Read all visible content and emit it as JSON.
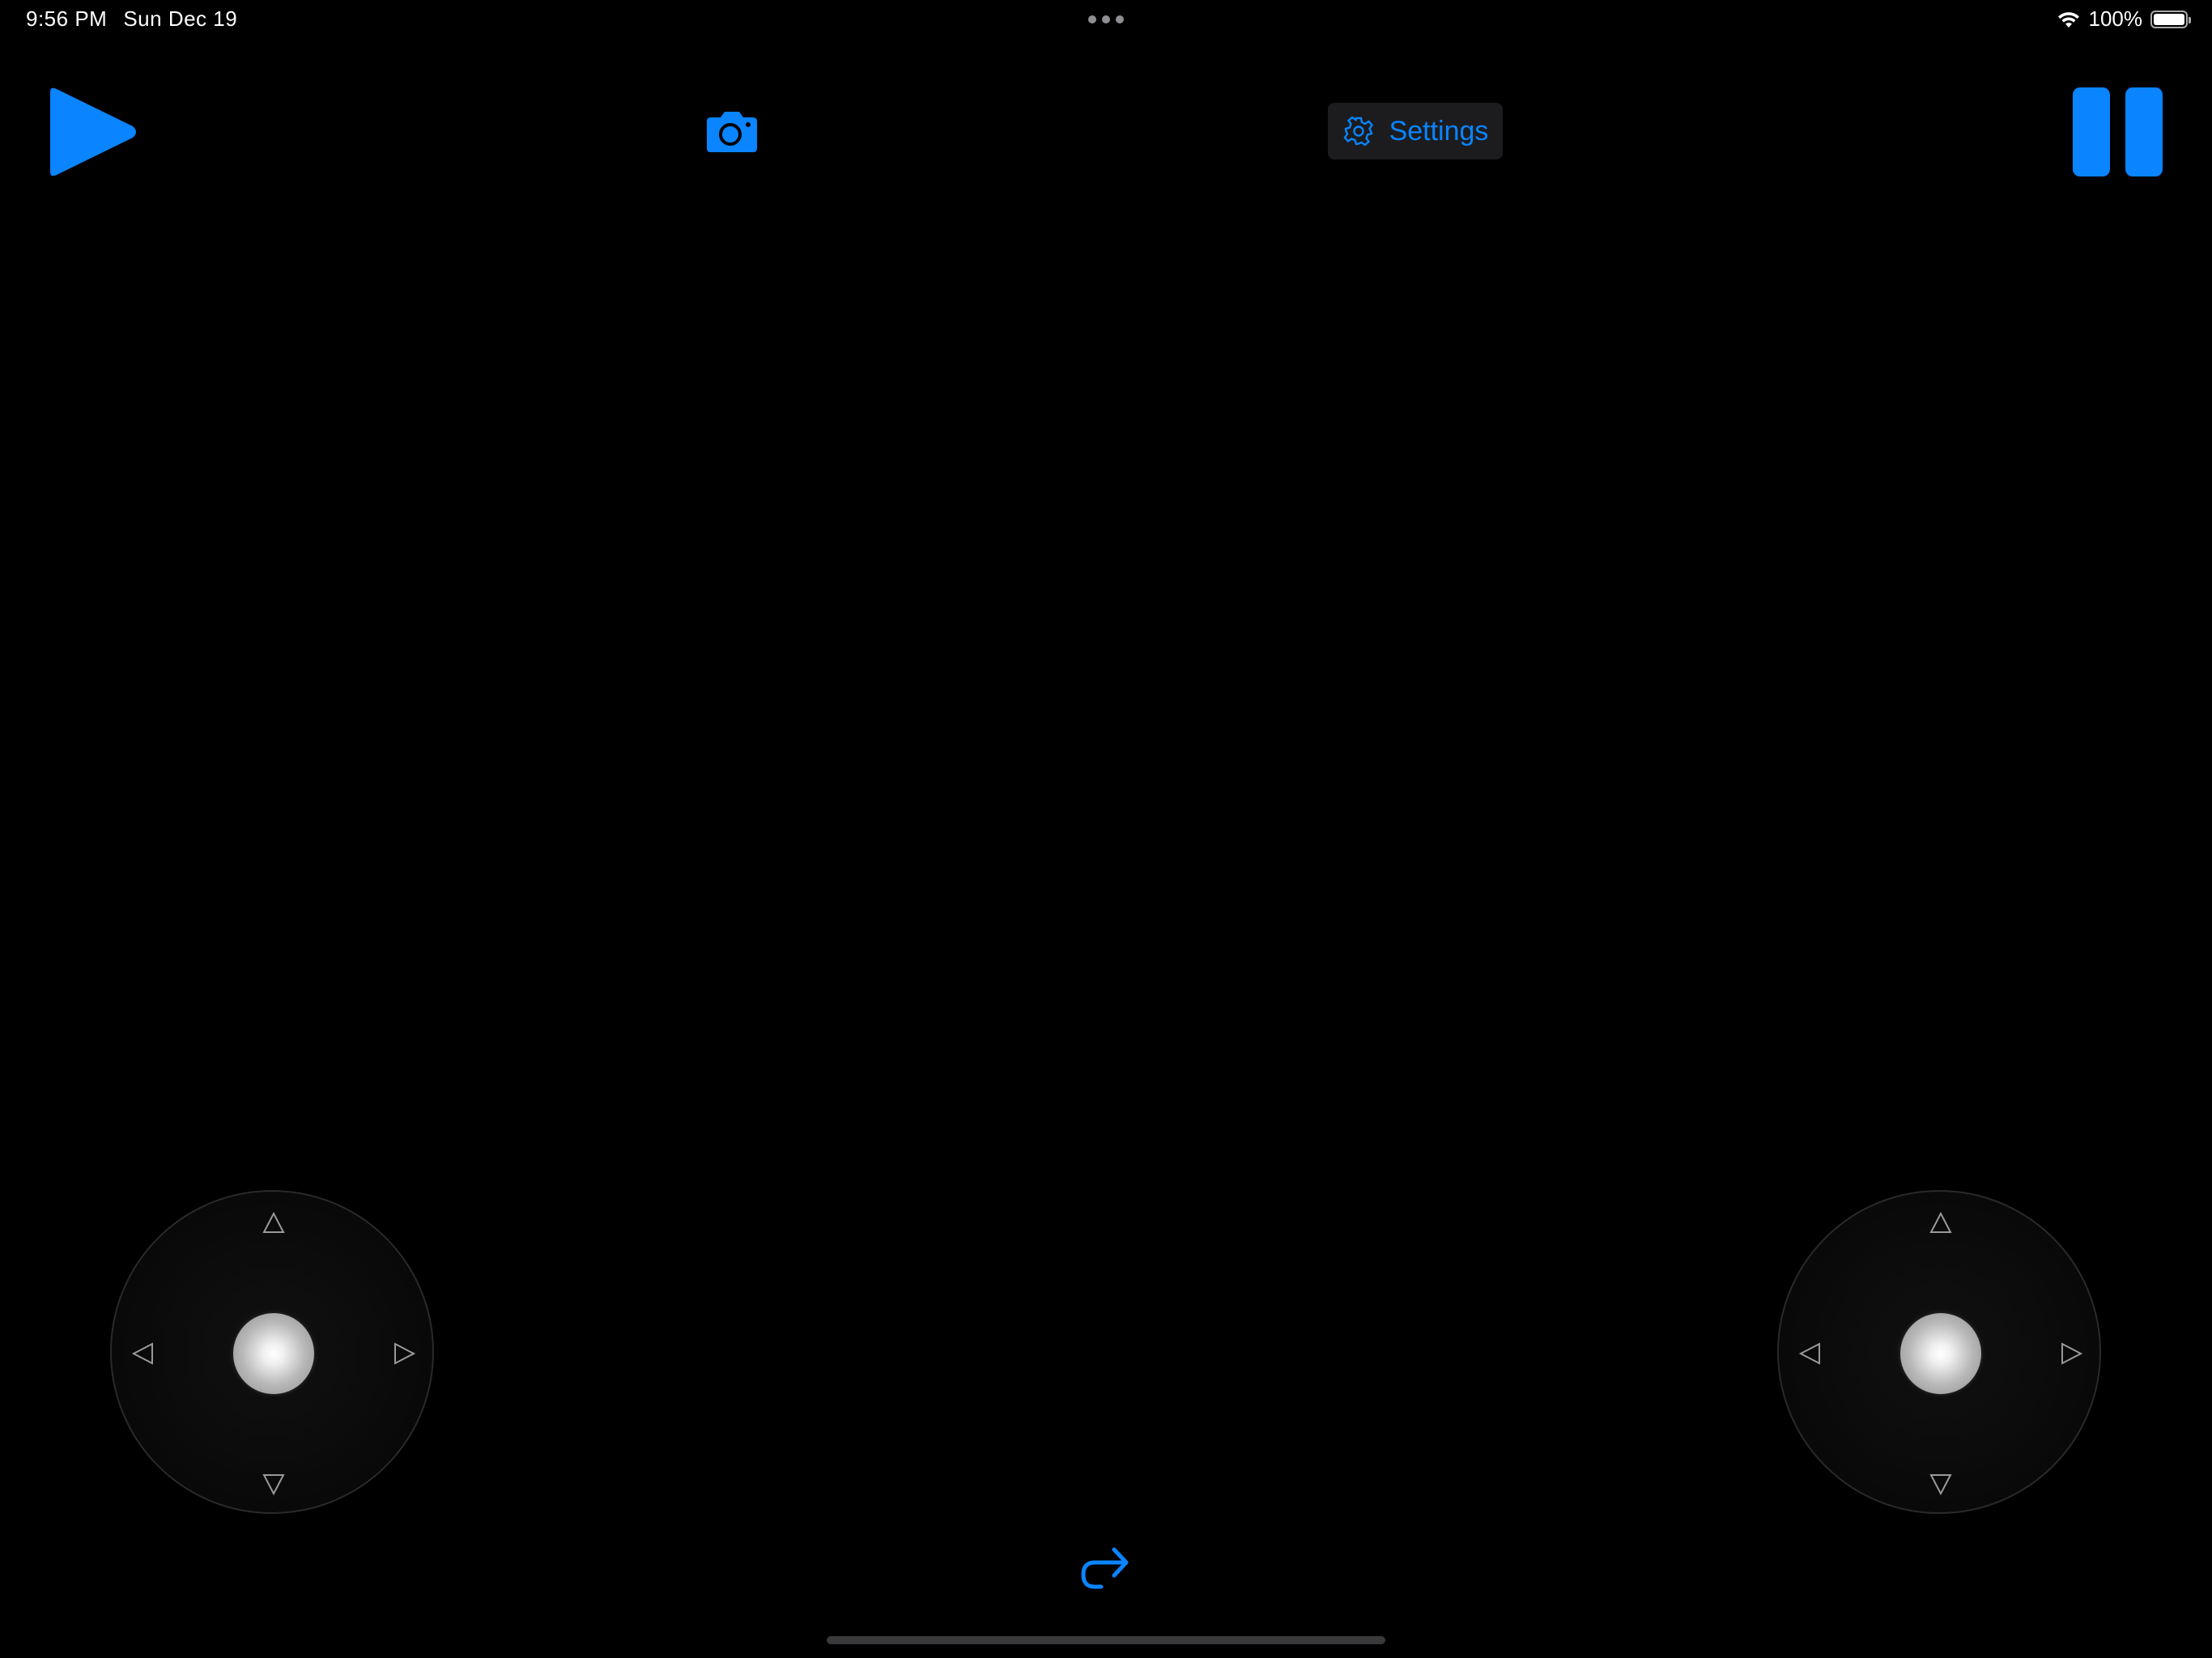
{
  "status_bar": {
    "time": "9:56 PM",
    "date": "Sun Dec 19",
    "battery_percent": "100%",
    "wifi_icon": "wifi-icon",
    "battery_icon": "battery-full-icon"
  },
  "toolbar": {
    "play_icon": "play-icon",
    "camera_icon": "camera-icon",
    "settings_label": "Settings",
    "settings_icon": "gear-icon",
    "pause_icon": "pause-icon"
  },
  "joysticks": [
    {
      "id": "left",
      "arrows": [
        "up-arrow-icon",
        "down-arrow-icon",
        "left-arrow-icon",
        "right-arrow-icon"
      ]
    },
    {
      "id": "right",
      "arrows": [
        "up-arrow-icon",
        "down-arrow-icon",
        "left-arrow-icon",
        "right-arrow-icon"
      ]
    }
  ],
  "bottom": {
    "redo_icon": "redo-arrow-icon"
  },
  "colors": {
    "accent": "#0a84ff",
    "background": "#000000",
    "settings_bg": "#1c1c1e"
  }
}
